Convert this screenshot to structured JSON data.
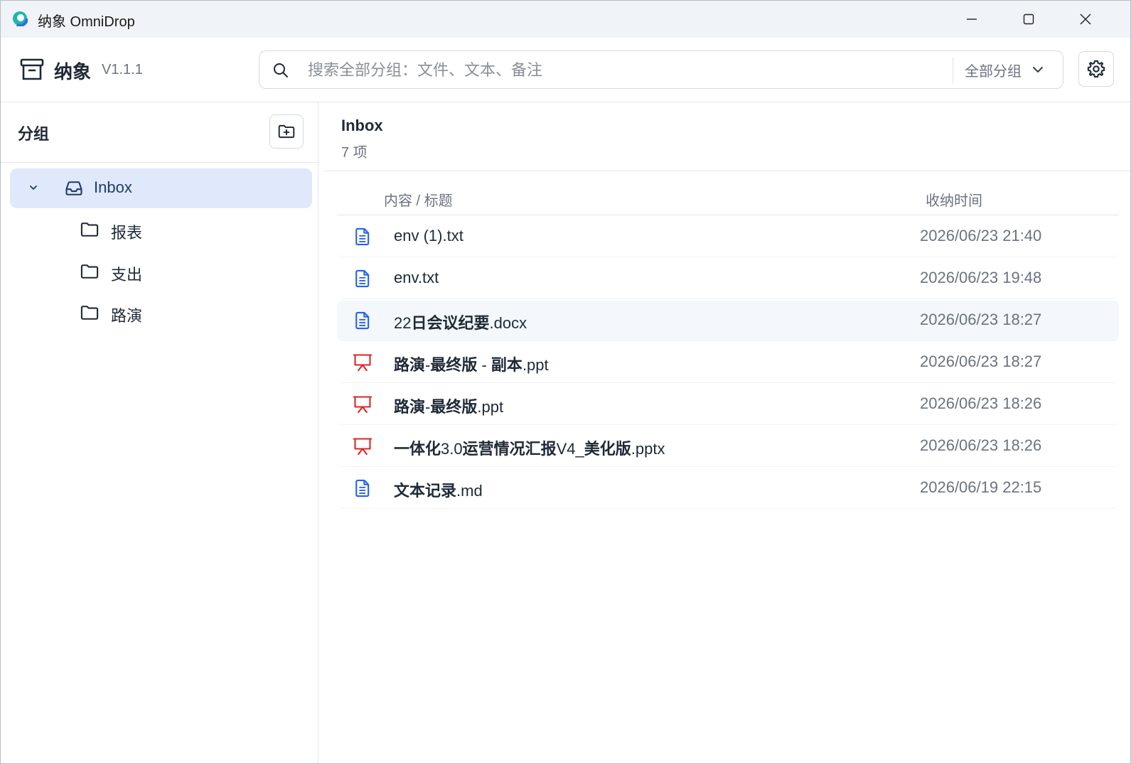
{
  "window": {
    "title": "纳象 OmniDrop"
  },
  "header": {
    "brand_name": "纳象",
    "version": "V1.1.1",
    "search_placeholder": "搜索全部分组：文件、文本、备注",
    "group_filter": "全部分组"
  },
  "sidebar": {
    "title": "分组",
    "groups": [
      {
        "label": "Inbox",
        "active": true,
        "icon": "inbox-icon"
      },
      {
        "label": "报表",
        "icon": "folder-icon"
      },
      {
        "label": "支出",
        "icon": "folder-icon"
      },
      {
        "label": "路演",
        "icon": "folder-icon"
      }
    ]
  },
  "main": {
    "title": "Inbox",
    "count": "7 项",
    "columns": {
      "content": "内容 / 标题",
      "time": "收纳时间"
    },
    "files": [
      {
        "name": "env (1).txt",
        "time": "2026/06/23 21:40",
        "type": "doc"
      },
      {
        "name": "env.txt",
        "time": "2026/06/23 19:48",
        "type": "doc"
      },
      {
        "name": "22日会议纪要.docx",
        "time": "2026/06/23 18:27",
        "type": "doc"
      },
      {
        "name": "路演-最终版 - 副本.ppt",
        "time": "2026/06/23 18:27",
        "type": "ppt"
      },
      {
        "name": "路演-最终版.ppt",
        "time": "2026/06/23 18:26",
        "type": "ppt"
      },
      {
        "name": "一体化3.0运营情况汇报V4_美化版.pptx",
        "time": "2026/06/23 18:26",
        "type": "ppt"
      },
      {
        "name": "文本记录.md",
        "time": "2026/06/19 22:15",
        "type": "doc"
      }
    ]
  },
  "colors": {
    "doc_icon": "#2563eb",
    "ppt_icon": "#dc2626",
    "active_bg": "#dfe9fb"
  }
}
